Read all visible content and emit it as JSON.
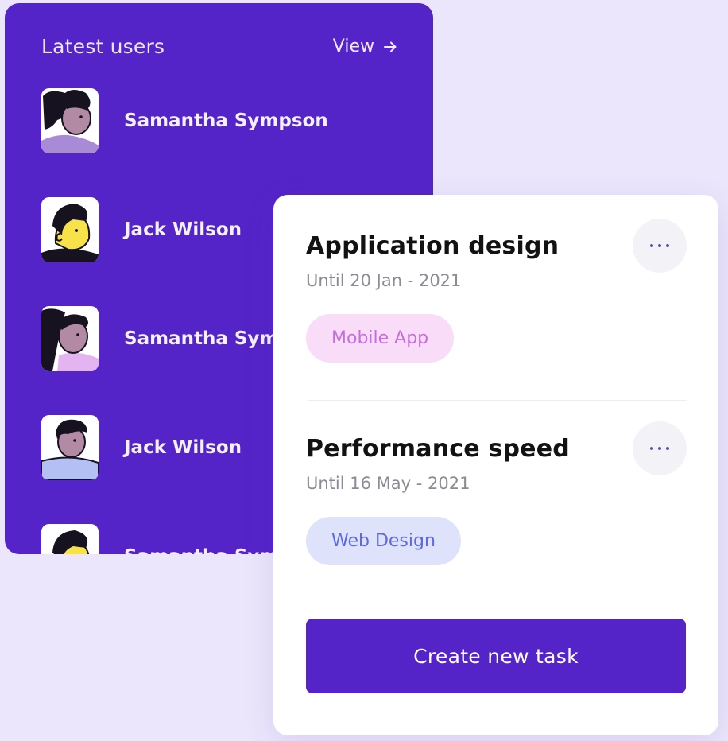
{
  "users_card": {
    "title": "Latest users",
    "view_label": "View",
    "users": [
      {
        "name": "Samantha Sympson",
        "avatar": "woman-purple-shirt"
      },
      {
        "name": "Jack Wilson",
        "avatar": "man-yellow-face"
      },
      {
        "name": "Samantha Sympson",
        "avatar": "woman-pink-shirt"
      },
      {
        "name": "Jack Wilson",
        "avatar": "man-blue-shirt"
      },
      {
        "name": "Samantha Sympson",
        "avatar": "man-yellow-face"
      }
    ]
  },
  "tasks_card": {
    "tasks": [
      {
        "title": "Application design",
        "date": "Until 20 Jan - 2021",
        "tag": "Mobile App",
        "tag_bg": "#f9dcf8",
        "tag_color": "#c86dde"
      },
      {
        "title": "Performance speed",
        "date": "Until 16 May - 2021",
        "tag": "Web Design",
        "tag_bg": "#dfe2fb",
        "tag_color": "#5b6ae0"
      }
    ],
    "create_button": "Create new task"
  },
  "colors": {
    "background": "#ebe6fb",
    "accent": "#5524c8",
    "card": "#ffffff"
  }
}
